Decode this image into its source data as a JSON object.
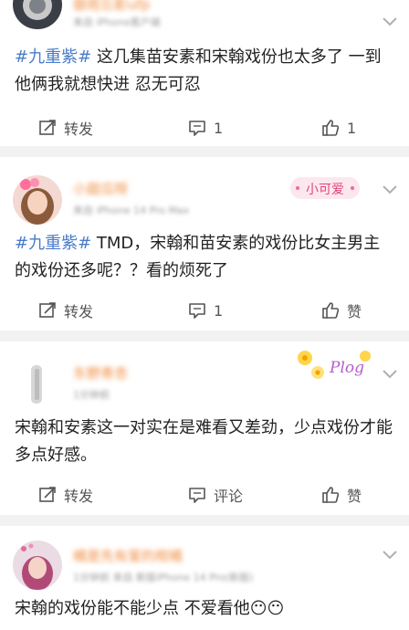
{
  "posts": [
    {
      "name": "御苑忘影ufp",
      "meta": "来自 iPhone客户端",
      "text_tag": "#九重紫#",
      "text_body": " 这几集苗安素和宋翰戏份也太多了 一到他俩我就想快进 忍无可忍",
      "repost_label": "转发",
      "comment_label": "1",
      "like_label": "1"
    },
    {
      "name": "小甜瓜呀",
      "meta": "来自 iPhone 14 Pro Max",
      "badge_text": "小可爱",
      "text_tag": "#九重紫#",
      "text_body": " TMD，宋翰和苗安素的戏份比女主男主的戏份还多呢？？看的烦死了",
      "repost_label": "转发",
      "comment_label": "1",
      "like_label": "赞"
    },
    {
      "name": "东野青杏",
      "meta": "1分钟前",
      "badge_text": "Plog",
      "text_body": "宋翰和安素这一对实在是难看又差劲，少点戏份才能多点好感。",
      "repost_label": "转发",
      "comment_label": "评论",
      "like_label": "赞"
    },
    {
      "name": "橘是先有爱的柑橘",
      "meta": "1分钟前 来自 新版iPhone 14 Pro(新版)",
      "text_body": "宋翰的戏份能不能少点 不爱看他😶😶"
    }
  ],
  "icons": {
    "repost": "repost-icon",
    "comment": "comment-icon",
    "like": "thumbs-up-icon",
    "more": "chevron-down-icon"
  },
  "colors": {
    "hashtag": "#4a7cc8",
    "username": "#f08a3c",
    "background": "#f2f2f2"
  }
}
